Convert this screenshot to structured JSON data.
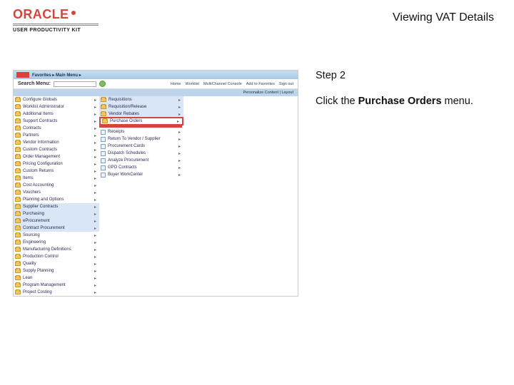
{
  "brand": {
    "name": "ORACLE",
    "sub": "USER PRODUCTIVITY KIT"
  },
  "title": "Viewing VAT Details",
  "step": {
    "label": "Step 2",
    "text_a": "Click the ",
    "bold": "Purchase Orders",
    "text_b": " menu."
  },
  "app": {
    "crumb_a": "Favorites",
    "crumb_b": "Main Menu",
    "search_label": "Search Menu:",
    "toplinks": [
      "Home",
      "Worklist",
      "MultiChannel Console",
      "Add to Favorites",
      "Sign out"
    ],
    "personalize": "Personalize Content | Layout",
    "col1": [
      "Configure Globals",
      "Worklist Administrator",
      "Additional Items",
      "Support Contracts",
      "Contracts",
      "Partners",
      "Vendor Information",
      "Custom Contracts",
      "Order Management",
      "Pricing Configuration",
      "Custom Returns",
      "Items",
      "Cost Accounting",
      "Vouchers",
      "Planning and Options",
      "Supplier Contracts",
      "Purchasing",
      "eProcurement",
      "Contract Procurement",
      "Sourcing",
      "Engineering",
      "Manufacturing Definitions",
      "Production Control",
      "Quality",
      "Supply Planning",
      "Lean",
      "Program Management",
      "Project Costing"
    ],
    "col2_top": [
      "Requisitions",
      "Requisition/Release",
      "Vendor Rebates"
    ],
    "col2_highlight": "Purchase Orders",
    "col2_leaf": [
      "Receipts",
      "Return To Vendor / Supplier",
      "Procurement Cards",
      "Dispatch Schedules",
      "Analyze Procurement",
      "GPO Contracts",
      "Buyer WorkCenter"
    ]
  }
}
